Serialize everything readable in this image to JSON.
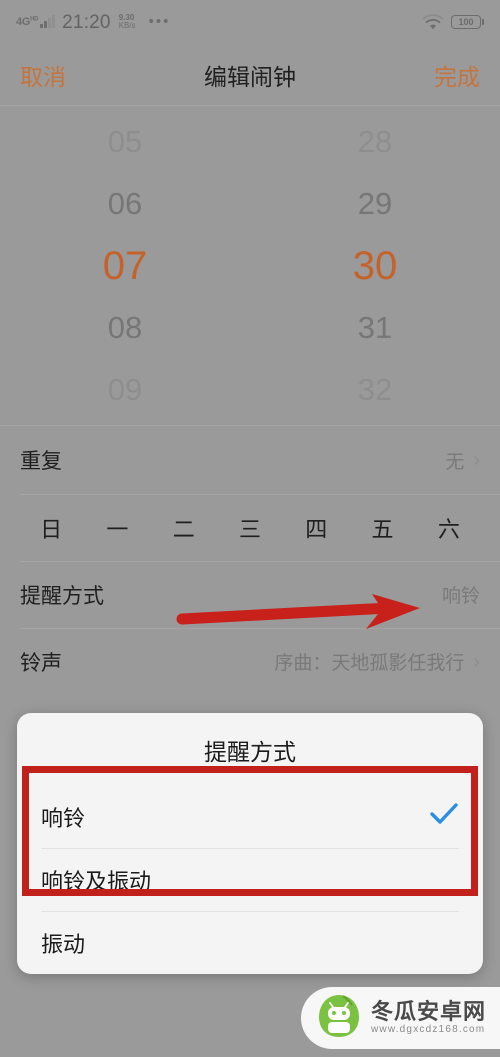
{
  "status_bar": {
    "network_label": "4G",
    "network_sup": "HD",
    "clock": "21:20",
    "speed_value": "9.30",
    "speed_unit": "KB/s",
    "more_dots": "•••",
    "wifi_icon": "wifi-icon",
    "battery_level": "100"
  },
  "title_bar": {
    "cancel_label": "取消",
    "title": "编辑闹钟",
    "done_label": "完成"
  },
  "time_picker": {
    "hours": [
      "05",
      "06",
      "07",
      "08",
      "09"
    ],
    "minutes": [
      "28",
      "29",
      "30",
      "31",
      "32"
    ],
    "selected_hour": "07",
    "selected_minute": "30",
    "selected_index": 2
  },
  "rows": {
    "repeat": {
      "label": "重复",
      "value": "无",
      "chevron": "›"
    },
    "remind": {
      "label": "提醒方式",
      "value": "响铃"
    },
    "ringtone": {
      "label": "铃声",
      "value": "序曲：天地孤影任我行",
      "chevron": "›"
    }
  },
  "weekdays": [
    "日",
    "一",
    "二",
    "三",
    "四",
    "五",
    "六"
  ],
  "dialog": {
    "title": "提醒方式",
    "options": [
      {
        "label": "响铃",
        "checked": true
      },
      {
        "label": "响铃及振动",
        "checked": false
      },
      {
        "label": "振动",
        "checked": false
      }
    ]
  },
  "annotations": {
    "arrow_color": "#c8201a",
    "box_color": "#c1211a"
  },
  "watermark": {
    "name": "冬瓜安卓网",
    "url": "www.dgxcdz168.com"
  },
  "colors": {
    "accent_orange": "#c4622a",
    "action_orange": "#c4753f",
    "check_blue": "#2a8fe0",
    "screen_bg": "#9a9a9a",
    "dialog_bg": "#f4f4f4"
  }
}
